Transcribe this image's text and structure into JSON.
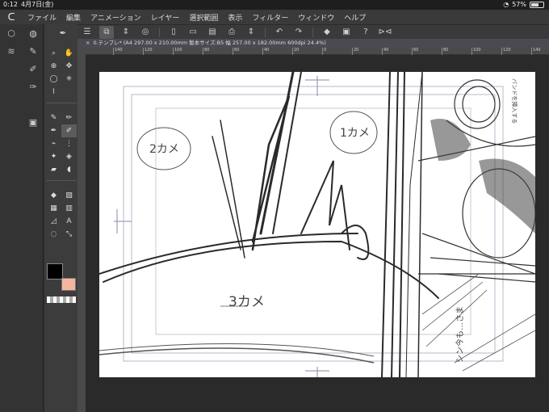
{
  "status": {
    "time": "0:12",
    "date": "4月7日(金)",
    "battery": "57%"
  },
  "menu": {
    "items": [
      "ファイル",
      "編集",
      "アニメーション",
      "レイヤー",
      "選択範囲",
      "表示",
      "フィルター",
      "ウィンドウ",
      "ヘルプ"
    ]
  },
  "toolbar": {
    "icons": [
      "menu-icon",
      "tool-property-icon",
      "chevron-updown-icon",
      "share-icon",
      "new-file-icon",
      "open-folder-icon",
      "save-icon",
      "print-icon",
      "chevron-updown-icon",
      "undo-icon",
      "redo-icon",
      "fill-icon",
      "layer-icon",
      "help-icon",
      "flip-icon"
    ]
  },
  "document": {
    "tab_title": "0.テンプレ* (A4 297.00 x 210.00mm 製本サイズ:B5 幅 257.00 x 182.00mm 600dpi 24.4%)"
  },
  "ruler": {
    "labels": [
      "140",
      "120",
      "100",
      "80",
      "60",
      "40",
      "20",
      "0",
      "20",
      "40",
      "60",
      "80",
      "100",
      "120",
      "140"
    ]
  },
  "canvas": {
    "sketch_labels": {
      "panel_2": "2カメ",
      "panel_1": "1カメ",
      "panel_3": "3カメ",
      "side_note": "シン今も…さま",
      "top_right_note": "バンドを挿入する"
    }
  },
  "colors": {
    "main": "#000000",
    "sub": "#f5b6a0",
    "accent": "#4a4a52"
  }
}
